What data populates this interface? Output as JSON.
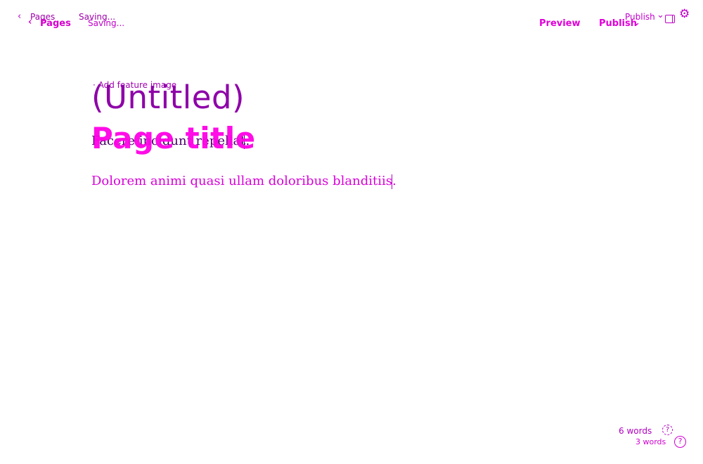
{
  "ghost_layer": {
    "back_icon": "‹",
    "pages_label": "Pages",
    "saving_label": "Saving...",
    "publish_label": "Publish",
    "publish_chevron": "⌄",
    "panel_icon": "sidebar-panel-icon",
    "gear_icon": "⚙",
    "add_feature_image": "· Add feature image",
    "title_placeholder": "(Untitled)",
    "paragraph": "Facere incidunt repellat.",
    "word_count": "6 words",
    "help_icon": "?"
  },
  "main_layer": {
    "back_icon": "‹",
    "pages_label": "Pages",
    "saving_label": "Saving...",
    "preview_label": "Preview",
    "publish_label": "Publish",
    "publish_chevron": "⌄",
    "page_title_placeholder": "Page title",
    "paragraph": "Dolorem animi quasi ullam doloribus blanditiis.",
    "word_count": "3 words",
    "help_icon": "?"
  },
  "colors": {
    "accent": "#e000d8",
    "accent_dark": "#8e00a8",
    "text_dark": "#4a006a"
  }
}
